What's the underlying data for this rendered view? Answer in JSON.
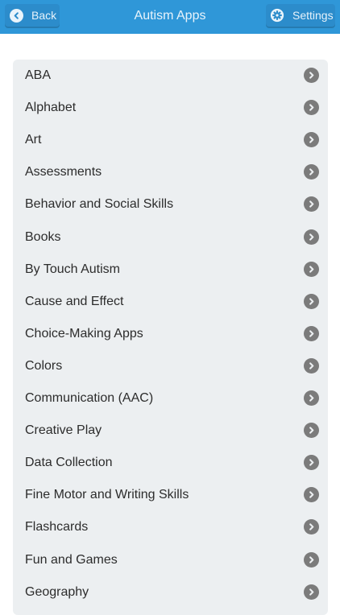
{
  "header": {
    "title": "Autism Apps",
    "back_label": "Back",
    "settings_label": "Settings",
    "background_color": "#2f97d8"
  },
  "categories": [
    {
      "label": "ABA"
    },
    {
      "label": "Alphabet"
    },
    {
      "label": "Art"
    },
    {
      "label": "Assessments"
    },
    {
      "label": "Behavior and Social Skills"
    },
    {
      "label": "Books"
    },
    {
      "label": "By Touch Autism"
    },
    {
      "label": "Cause and Effect"
    },
    {
      "label": "Choice-Making Apps"
    },
    {
      "label": "Colors"
    },
    {
      "label": "Communication (AAC)"
    },
    {
      "label": "Creative Play"
    },
    {
      "label": "Data Collection"
    },
    {
      "label": "Fine Motor and Writing Skills"
    },
    {
      "label": "Flashcards"
    },
    {
      "label": "Fun and Games"
    },
    {
      "label": "Geography"
    }
  ],
  "icons": {
    "back": "chevron-left-icon",
    "settings": "gear-icon",
    "row_action": "chevron-right-icon"
  }
}
